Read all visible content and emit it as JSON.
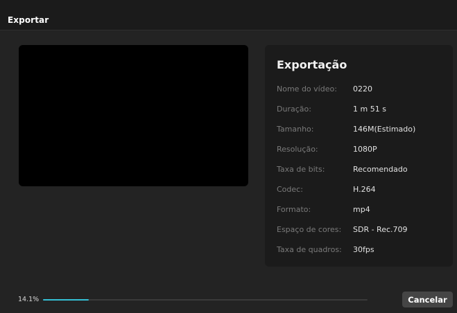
{
  "window": {
    "title": "Exportar"
  },
  "preview": {},
  "export_info": {
    "title": "Exportação",
    "rows": [
      {
        "label": "Nome do vídeo:",
        "value": "0220"
      },
      {
        "label": "Duração:",
        "value": "1 m 51 s"
      },
      {
        "label": "Tamanho:",
        "value": "146M(Estimado)"
      },
      {
        "label": "Resolução:",
        "value": "1080P"
      },
      {
        "label": "Taxa de bits:",
        "value": "Recomendado"
      },
      {
        "label": "Codec:",
        "value": "H.264"
      },
      {
        "label": "Formato:",
        "value": "mp4"
      },
      {
        "label": "Espaço de cores:",
        "value": "SDR - Rec.709"
      },
      {
        "label": "Taxa de quadros:",
        "value": "30fps"
      }
    ]
  },
  "progress": {
    "text": "14.1%",
    "fraction": 0.141,
    "color": "#35c1d6"
  },
  "footer": {
    "cancel_label": "Cancelar"
  }
}
